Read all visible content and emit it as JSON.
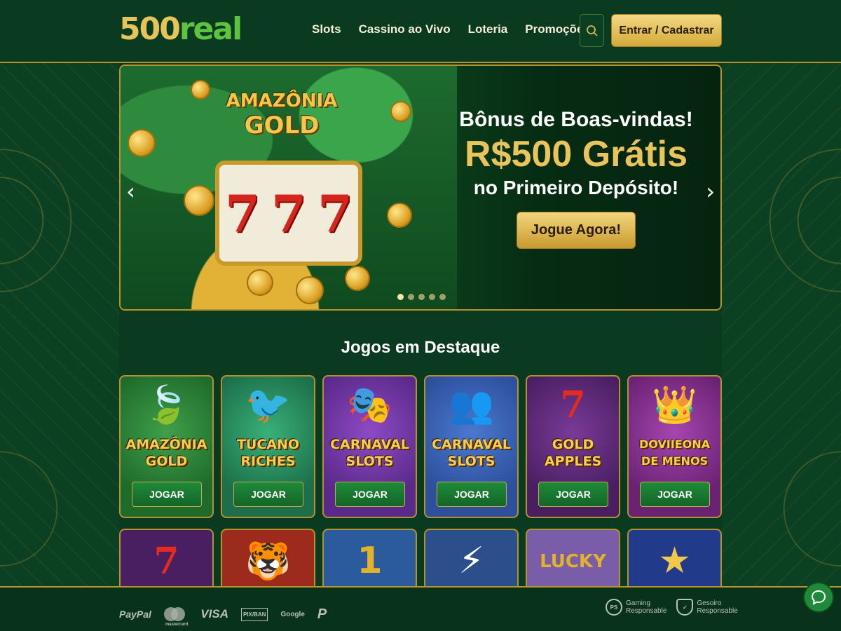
{
  "header": {
    "logo_num": "500",
    "logo_word": "real",
    "nav": [
      "Slots",
      "Cassino ao Vivo",
      "Loteria",
      "Promoções"
    ],
    "search_icon": "search-icon",
    "login_label": "Entrar / Cadastrar"
  },
  "hero": {
    "slot_title_1": "AMAZÔNIA",
    "slot_title_2": "GOLD",
    "reels": [
      "7",
      "7",
      "7"
    ],
    "line1": "Bônus de Boas-vindas!",
    "line2": "R$500 Grátis",
    "line3": "no Primeiro Depósito!",
    "cta": "Jogue Agora!",
    "prev_icon": "chevron-left-icon",
    "next_icon": "chevron-right-icon",
    "dots_count": 5,
    "active_dot": 0
  },
  "section_title": "Jogos em Destaque",
  "games": [
    {
      "title1": "AMAZÔNIA",
      "title2": "GOLD",
      "button": "JOGAR",
      "bg": "#1f6b2a",
      "icon": "leaf-icon"
    },
    {
      "title1": "TUCANO",
      "title2": "RICHES",
      "button": "JOGAR",
      "bg": "#1c6f4a",
      "icon": "toucan-icon"
    },
    {
      "title1": "CARNAVAL",
      "title2": "SLOTS",
      "button": "JOGAR",
      "bg": "#5a2a8a",
      "icon": "mask-icon"
    },
    {
      "title1": "CARNAVAL",
      "title2": "SLOTS",
      "button": "JOGAR",
      "bg": "#2d4f9c",
      "icon": "people-icon"
    },
    {
      "title1": "GOLD",
      "title2": "APPLES",
      "button": "JOGAR",
      "bg": "#4a1f62",
      "icon": "seven-icon"
    },
    {
      "title1": "DOVIIEONA",
      "title2": "DE MENOS",
      "button": "JOGAR",
      "bg": "#6a2373",
      "icon": "king-icon"
    }
  ],
  "games_row2": [
    {
      "bg": "#4a1f62",
      "icon": "seven-icon",
      "symbol": "7"
    },
    {
      "bg": "#9c2a1d",
      "icon": "tiger-icon",
      "symbol": "🐯"
    },
    {
      "bg": "#2b5b9c",
      "icon": "one-icon",
      "symbol": "1"
    },
    {
      "bg": "#2a4f8a",
      "icon": "zeus-icon",
      "symbol": "⚡"
    },
    {
      "bg": "#7a5da8",
      "icon": "lucky-icon",
      "symbol": "LUCKY"
    },
    {
      "bg": "#223a8a",
      "icon": "star-icon",
      "symbol": "★"
    }
  ],
  "footer": {
    "payments": [
      "PayPal",
      "mastercard",
      "VISA",
      "PIX/BAN",
      "Google",
      "P"
    ],
    "responsible": [
      {
        "badge": "PS",
        "text1": "Gaming",
        "text2": "Responsable"
      },
      {
        "badge": "✓",
        "text1": "Gesoiro",
        "text2": "Responsable"
      }
    ],
    "chat_icon": "chat-icon"
  },
  "colors": {
    "accent_gold": "#e7c45a",
    "brand_green": "#5cc441",
    "bg": "#0a3a1f"
  }
}
